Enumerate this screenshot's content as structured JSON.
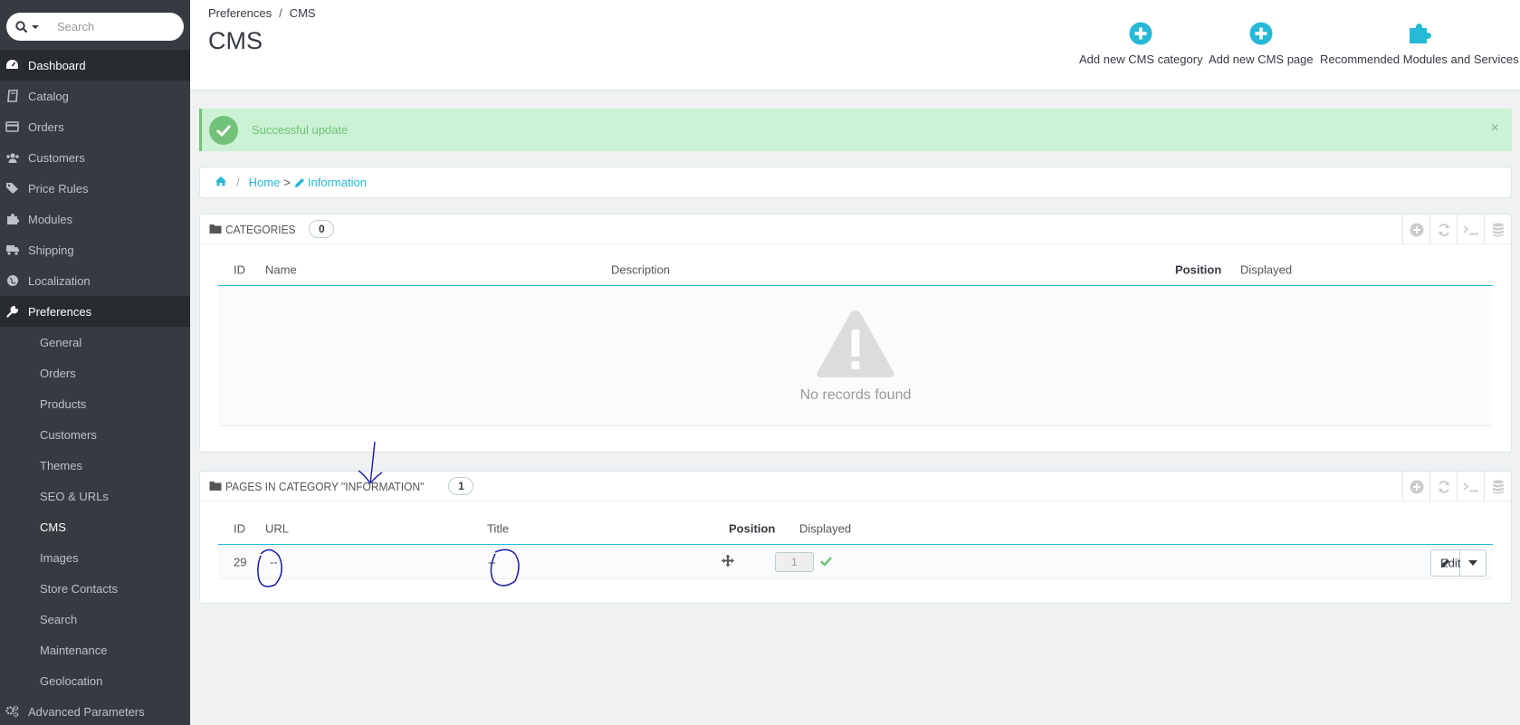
{
  "sidebar": {
    "search": {
      "placeholder": "Search"
    },
    "items": [
      {
        "label": "Dashboard",
        "icon": "dashboard-icon"
      },
      {
        "label": "Catalog",
        "icon": "book-icon"
      },
      {
        "label": "Orders",
        "icon": "credit-card-icon"
      },
      {
        "label": "Customers",
        "icon": "users-icon"
      },
      {
        "label": "Price Rules",
        "icon": "tags-icon"
      },
      {
        "label": "Modules",
        "icon": "puzzle-icon"
      },
      {
        "label": "Shipping",
        "icon": "truck-icon"
      },
      {
        "label": "Localization",
        "icon": "globe-icon"
      },
      {
        "label": "Preferences",
        "icon": "wrench-icon"
      }
    ],
    "submenu": [
      "General",
      "Orders",
      "Products",
      "Customers",
      "Themes",
      "SEO & URLs",
      "CMS",
      "Images",
      "Store Contacts",
      "Search",
      "Maintenance",
      "Geolocation"
    ],
    "bottom_item": {
      "label": "Advanced Parameters",
      "icon": "cogs-icon"
    }
  },
  "header": {
    "breadcrumb": [
      "Preferences",
      "CMS"
    ],
    "title": "CMS",
    "toolbar": {
      "add_category": "Add new CMS category",
      "add_page": "Add new CMS page",
      "recommended": "Recommended Modules and Services"
    }
  },
  "alert": {
    "text": "Successful update",
    "close": "×"
  },
  "crumbs": {
    "home": "Home",
    "gt": ">",
    "current": "Information"
  },
  "categories_panel": {
    "title": "CATEGORIES",
    "count": "0",
    "columns": [
      "ID",
      "Name",
      "Description",
      "Position",
      "Displayed"
    ],
    "empty_text": "No records found"
  },
  "pages_panel": {
    "title": "PAGES IN CATEGORY \"INFORMATION\"",
    "count": "1",
    "columns": [
      "ID",
      "URL",
      "Title",
      "Position",
      "Displayed"
    ],
    "rows": [
      {
        "id": "29",
        "url": "--",
        "title": "--",
        "position": "1",
        "displayed": true,
        "edit": "Edit"
      }
    ]
  },
  "colors": {
    "accent": "#25b9d7",
    "success": "#72c279",
    "sidebar_bg": "#363a41"
  }
}
